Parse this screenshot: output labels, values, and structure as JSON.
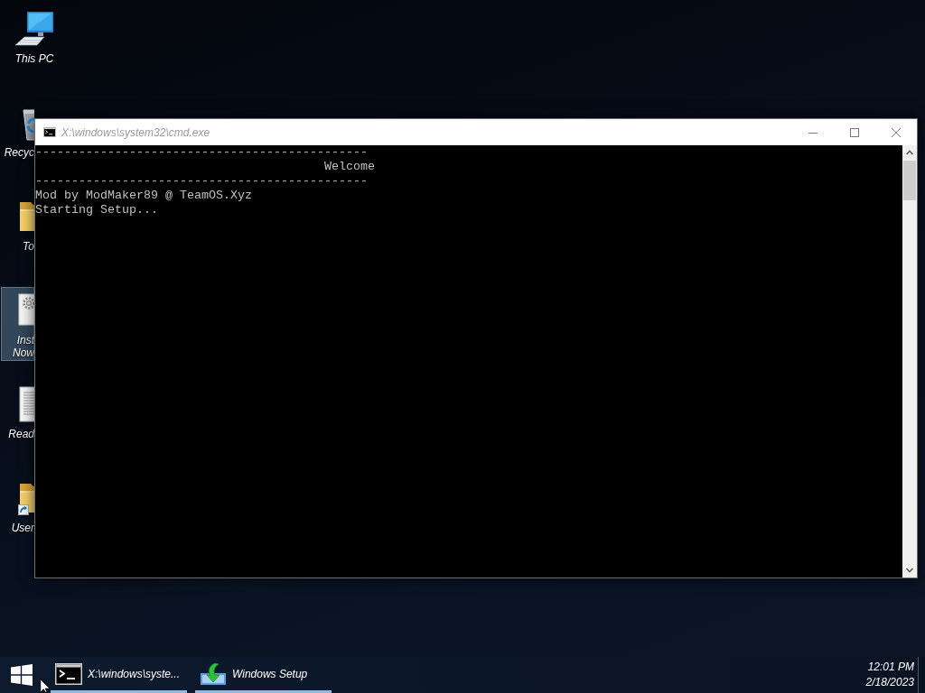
{
  "desktop_icons": [
    {
      "label": "This PC",
      "kind": "computer",
      "selected": false
    },
    {
      "label": "Recyc",
      "kind": "bin",
      "selected": false
    },
    {
      "label": "To",
      "kind": "folder",
      "selected": false
    },
    {
      "label": "Inst Now",
      "kind": "setup",
      "selected": true
    },
    {
      "label": "Read",
      "kind": "document",
      "selected": false
    },
    {
      "label": "User",
      "kind": "shortcut",
      "selected": false
    }
  ],
  "window": {
    "title": "X:\\windows\\system32\\cmd.exe",
    "console_output": "----------------------------------------------\n                                        Welcome\n----------------------------------------------\nMod by ModMaker89 @ TeamOS.Xyz\nStarting Setup..."
  },
  "taskbar": {
    "items": [
      {
        "label": "X:\\windows\\syste...",
        "kind": "console",
        "running": true
      },
      {
        "label": "Windows Setup",
        "kind": "setup",
        "running": true
      }
    ],
    "clock": {
      "time": "12:01 PM",
      "date": "2/18/2023"
    }
  }
}
